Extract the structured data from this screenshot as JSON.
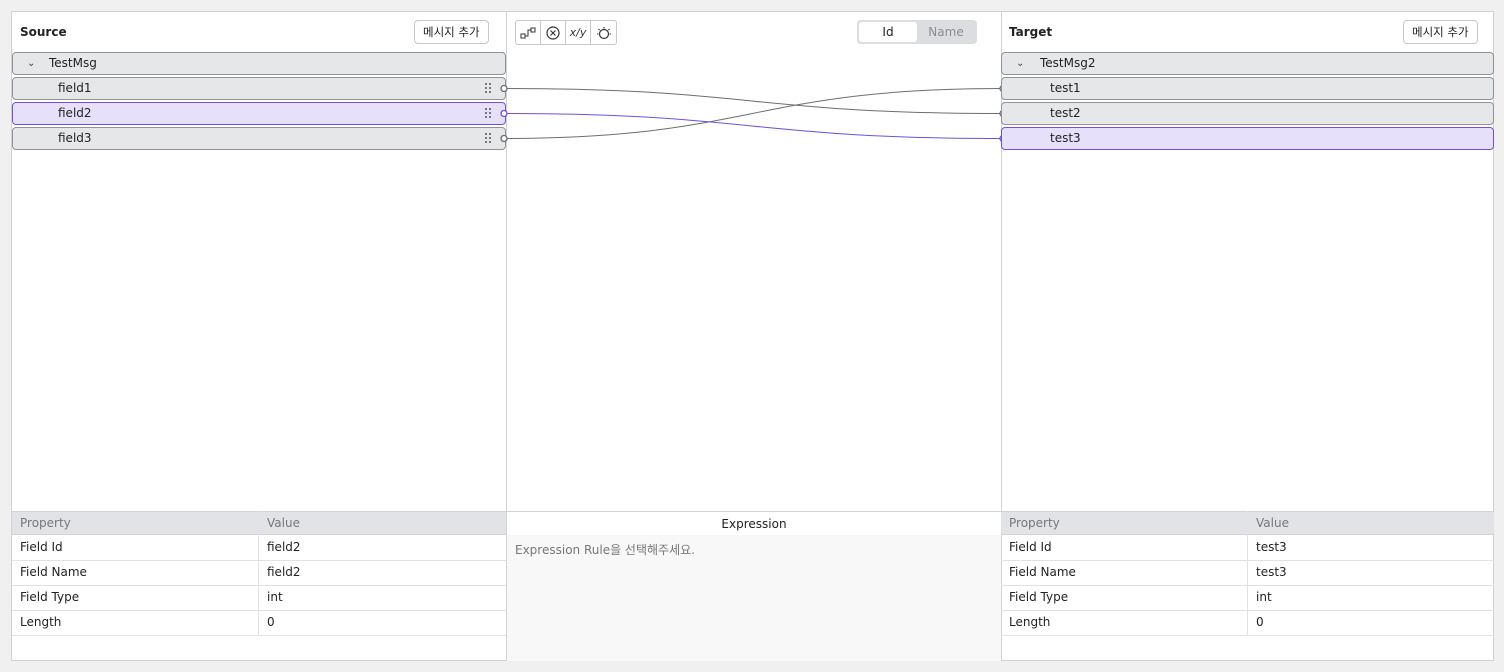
{
  "source": {
    "title": "Source",
    "add_button": "메시지 추가",
    "message": "TestMsg",
    "fields": [
      "field1",
      "field2",
      "field3"
    ]
  },
  "target": {
    "title": "Target",
    "add_button": "메시지 추가",
    "message": "TestMsg2",
    "fields": [
      "test1",
      "test2",
      "test3"
    ]
  },
  "toolbar": {
    "icons": [
      "connect-icon",
      "clear-icon",
      "fraction-icon",
      "bulb-icon"
    ],
    "fraction_glyph": "x/y"
  },
  "toggle": {
    "id_label": "Id",
    "name_label": "Name",
    "selected": "Id"
  },
  "mappings": [
    {
      "from": "field1",
      "to": "test2",
      "selected": false
    },
    {
      "from": "field2",
      "to": "test3",
      "selected": true
    },
    {
      "from": "field3",
      "to": "test1",
      "selected": false
    }
  ],
  "colors": {
    "selected": "#7450d8",
    "line": "#6b6e73",
    "row_bg": "#e6e7e9",
    "row_sel_bg": "#e7e0fb"
  },
  "source_props": {
    "col_property": "Property",
    "col_value": "Value",
    "rows": [
      {
        "label": "Field Id",
        "value": "field2"
      },
      {
        "label": "Field Name",
        "value": "field2"
      },
      {
        "label": "Field Type",
        "value": "int"
      },
      {
        "label": "Length",
        "value": "0"
      }
    ]
  },
  "target_props": {
    "col_property": "Property",
    "col_value": "Value",
    "rows": [
      {
        "label": "Field Id",
        "value": "test3"
      },
      {
        "label": "Field Name",
        "value": "test3"
      },
      {
        "label": "Field Type",
        "value": "int"
      },
      {
        "label": "Length",
        "value": "0"
      }
    ]
  },
  "expression": {
    "title": "Expression",
    "placeholder": "Expression Rule을 선택해주세요."
  }
}
